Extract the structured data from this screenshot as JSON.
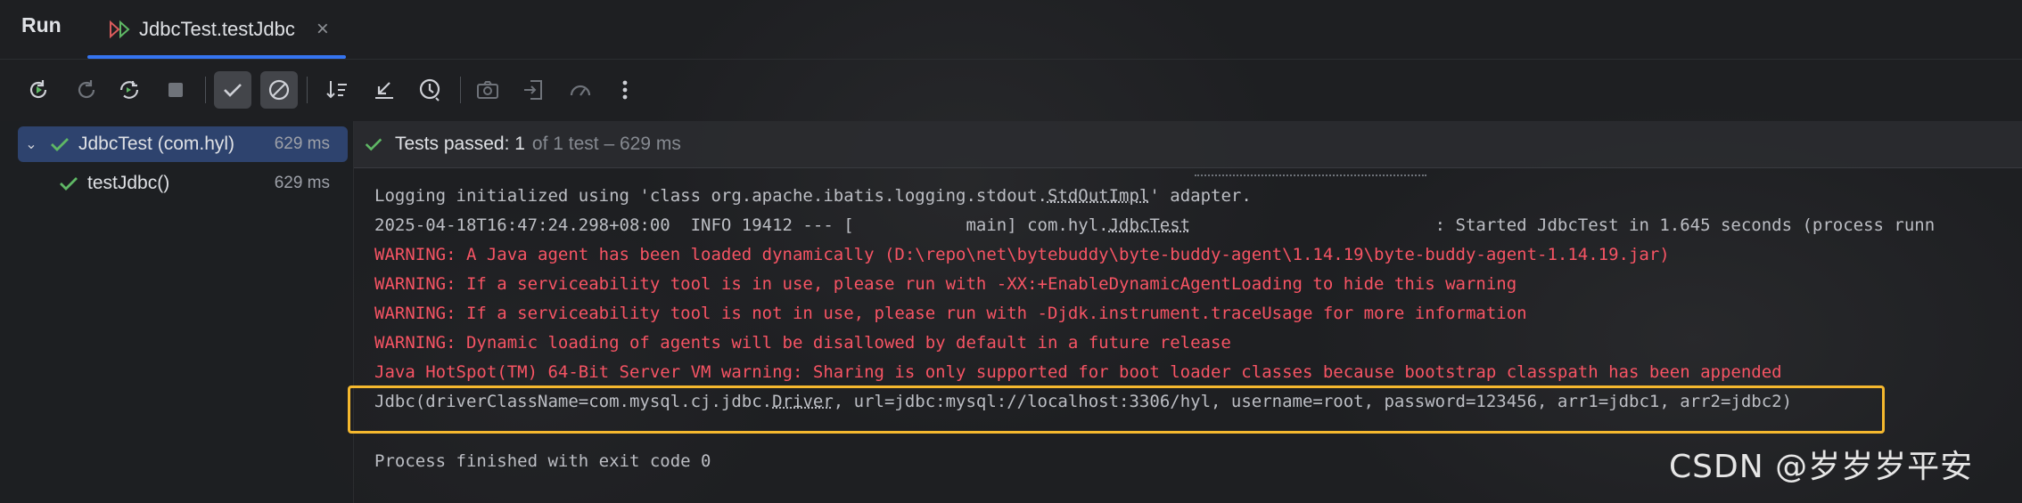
{
  "header": {
    "run_label": "Run",
    "tab_label": "JdbcTest.testJdbc",
    "tab_close": "×"
  },
  "toolbar": {
    "buttons": [
      {
        "name": "rerun-icon",
        "enabled": true
      },
      {
        "name": "rerun-failed-icon",
        "enabled": false
      },
      {
        "name": "toggle-auto-test-icon",
        "enabled": true
      },
      {
        "name": "stop-icon",
        "enabled": false
      },
      {
        "name": "show-passed-icon",
        "enabled": true,
        "active": true
      },
      {
        "name": "show-ignored-icon",
        "enabled": true,
        "active": true
      },
      {
        "name": "sort-alphabetically-icon",
        "enabled": true
      },
      {
        "name": "collapse-all-icon",
        "enabled": true
      },
      {
        "name": "test-history-icon",
        "enabled": true
      },
      {
        "name": "screenshot-icon",
        "enabled": false
      },
      {
        "name": "import-tests-icon",
        "enabled": false
      },
      {
        "name": "coverage-icon",
        "enabled": false
      },
      {
        "name": "more-options-icon",
        "enabled": true
      }
    ]
  },
  "tree": {
    "items": [
      {
        "name": "JdbcTest (com.hyl)",
        "time": "629 ms",
        "selected": true
      },
      {
        "name": "testJdbc()",
        "time": "629 ms",
        "selected": false
      }
    ]
  },
  "status": {
    "passed": "Tests passed: 1",
    "rest": "of 1 test – 629 ms"
  },
  "console": {
    "lines": [
      {
        "type": "normal",
        "pre": "Logging initialized using 'class org.apache.ibatis.logging.stdout.",
        "u": "StdOutImpl",
        "post": "' adapter."
      },
      {
        "type": "normal",
        "pre": "2025-04-18T16:47:24.298+08:00  INFO 19412 --- [           main] com.hyl.",
        "u": "JdbcTest",
        "post": "                        : Started JdbcTest in 1.645 seconds (process runn"
      },
      {
        "type": "warn",
        "pre": "WARNING: A Java agent has been loaded dynamically (D:\\repo\\net\\bytebuddy\\byte-buddy-agent\\1.14.19\\byte-buddy-agent-1.14.19.jar)",
        "u": "",
        "post": ""
      },
      {
        "type": "warn",
        "pre": "WARNING: If a serviceability tool is in use, please run with -XX:+EnableDynamicAgentLoading to hide this warning",
        "u": "",
        "post": ""
      },
      {
        "type": "warn",
        "pre": "WARNING: If a serviceability tool is not in use, please run with -Djdk.instrument.traceUsage for more information",
        "u": "",
        "post": ""
      },
      {
        "type": "warn",
        "pre": "WARNING: Dynamic loading of agents will be disallowed by default in a future release",
        "u": "",
        "post": ""
      },
      {
        "type": "warn",
        "pre": "Java HotSpot(TM) 64-Bit Server VM warning: Sharing is only supported for boot loader classes because bootstrap classpath has been appended",
        "u": "",
        "post": ""
      },
      {
        "type": "normal",
        "pre": "Jdbc(driverClassName=com.mysql.cj.jdbc.",
        "u": "Driver",
        "post": ", url=jdbc:mysql://localhost:3306/hyl, username=root, password=123456, arr1=jdbc1, arr2=jdbc2)"
      },
      {
        "type": "normal",
        "pre": "",
        "u": "",
        "post": ""
      },
      {
        "type": "normal",
        "pre": "Process finished with exit code 0",
        "u": "",
        "post": ""
      }
    ]
  },
  "watermark": "CSDN @岁岁岁平安",
  "colors": {
    "accent": "#3574f0",
    "passed_green": "#5fb865",
    "warning_red": "#f75464",
    "highlight": "#f5b82e",
    "selection": "#2e436e"
  }
}
